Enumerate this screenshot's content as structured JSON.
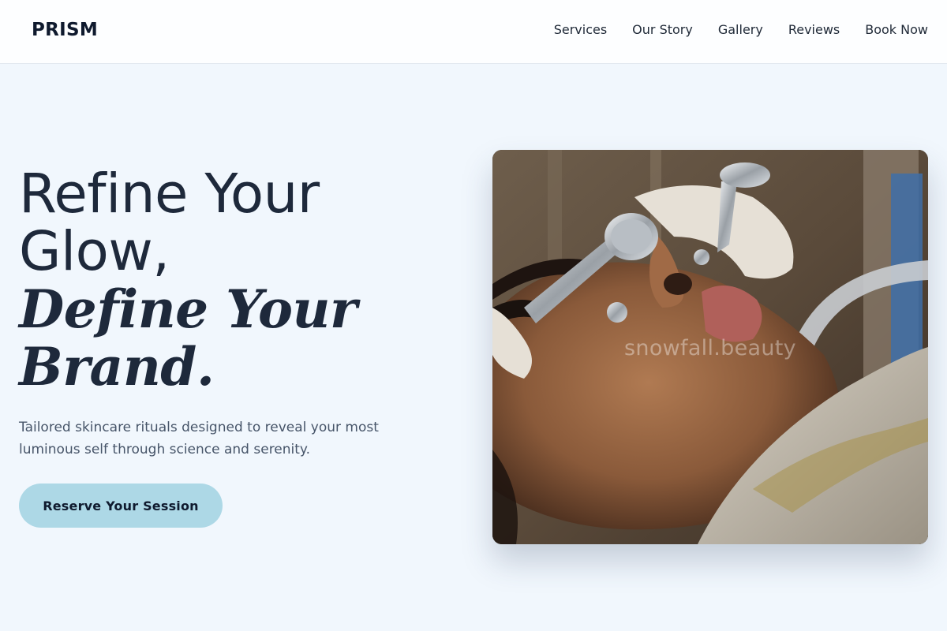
{
  "brand": {
    "logo_text": "PRISM"
  },
  "nav": {
    "items": [
      "Services",
      "Our Story",
      "Gallery",
      "Reviews",
      "Book Now"
    ]
  },
  "hero": {
    "headline_line1": "Refine Your",
    "headline_line2": "Glow,",
    "headline_italic_line1": "Define Your",
    "headline_italic_line2": "Brand.",
    "subtitle": "Tailored skincare rituals designed to reveal your most luminous self through science and serenity.",
    "cta_label": "Reserve Your Session"
  },
  "image": {
    "alt": "Facial treatment with steel cryo rollers",
    "watermark": "snowfall.beauty"
  },
  "colors": {
    "background": "#f1f7fd",
    "header": "#fdfeff",
    "accent": "#add8e6",
    "text_dark": "#1e293b",
    "text_muted": "#475569"
  }
}
